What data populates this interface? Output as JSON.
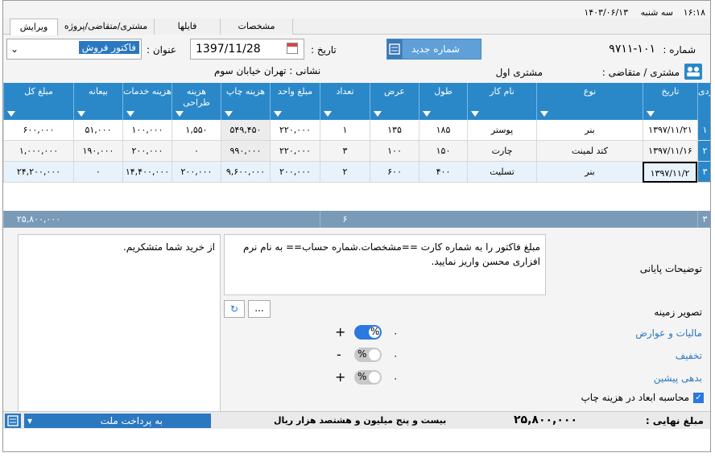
{
  "topbar": {
    "time": "۱۶:۱۸",
    "day": "سه شنبه",
    "date": "۱۴۰۳/۰۶/۱۳"
  },
  "tabs": [
    "ویرایش",
    "مشتری/متقاضی/پروژه",
    "فایلها",
    "مشخصات"
  ],
  "header": {
    "number_label": "شماره :",
    "number_value": "۹۷۱۱-۱۰۱",
    "new_number": "شماره جدید",
    "date_label": "تاریخ :",
    "date_value": "1397/11/28",
    "title_label": "عنوان :",
    "title_value": "فاکتور فروش",
    "customer_label": "مشتری / متقاضی :",
    "customer_value": "مشتری اول",
    "address": "نشانی : تهران خیابان سوم"
  },
  "grid": {
    "columns": [
      "ردی",
      "تاریخ",
      "نوع",
      "نام کار",
      "طول",
      "عرض",
      "تعداد",
      "مبلغ واحد",
      "هزینه چاپ",
      "هزینه طراحی",
      "هزینه خدمات",
      "بیعانه",
      "مبلغ کل"
    ],
    "rows": [
      [
        "۱",
        "۱۳۹۷/۱۱/۲۱",
        "بنر",
        "پوستر",
        "۱۸۵",
        "۱۳۵",
        "۱",
        "۲۲۰,۰۰۰",
        "۵۴۹,۴۵۰",
        "۱,۵۵۰",
        "۱۰۰,۰۰۰",
        "۵۱,۰۰۰",
        "۶۰۰,۰۰۰"
      ],
      [
        "۲",
        "۱۳۹۷/۱۱/۱۶",
        "کتد لمینت",
        "چارت",
        "۱۵۰",
        "۱۰۰",
        "۳",
        "۲۲۰,۰۰۰",
        "۹۹۰,۰۰۰",
        "۰",
        "۲۰۰,۰۰۰",
        "۱۹۰,۰۰۰",
        "۱,۰۰۰,۰۰۰"
      ],
      [
        "۳",
        "۱۳۹۷/۱۱/۲",
        "بنر",
        "تسلیت",
        "۴۰۰",
        "۶۰۰",
        "۲",
        "۲۰۰,۰۰۰",
        "۹,۶۰۰,۰۰۰",
        "۲۰۰,۰۰۰",
        "۱۴,۴۰۰,۰۰۰",
        "۰",
        "۲۴,۲۰۰,۰۰۰"
      ]
    ],
    "summary": {
      "count": "۳",
      "qty": "۶",
      "total": "۲۵,۸۰۰,۰۰۰"
    }
  },
  "notes": {
    "bank_text": "مبلغ فاکتور را به شماره کارت ==مشخصات.شماره حساب== به نام نرم افزاری محسن واریز نمایید.",
    "thanks_text": "از خرید شما متشکریم.",
    "footer_label": "توضیحات پایانی"
  },
  "options": {
    "background_image": "تصویر زمینه",
    "tax": "مالیات و عوارض",
    "discount": "تخفیف",
    "prev_debt": "بدهی پیشین",
    "calc_dims": "محاسبه ابعاد در هزینه چاپ",
    "percent": "%",
    "zero": "۰",
    "plus": "+",
    "minus": "-",
    "dots": "..."
  },
  "bottom": {
    "final_label": "مبلغ نهایی :",
    "final_value": "۲۵,۸۰۰,۰۰۰",
    "words": "بیست و پنج میلیون و هشتصد هزار ریال",
    "payment": "به پرداخت ملت"
  },
  "colors": {
    "header_blue": "#2a88c9",
    "accent": "#5fa0d8"
  }
}
